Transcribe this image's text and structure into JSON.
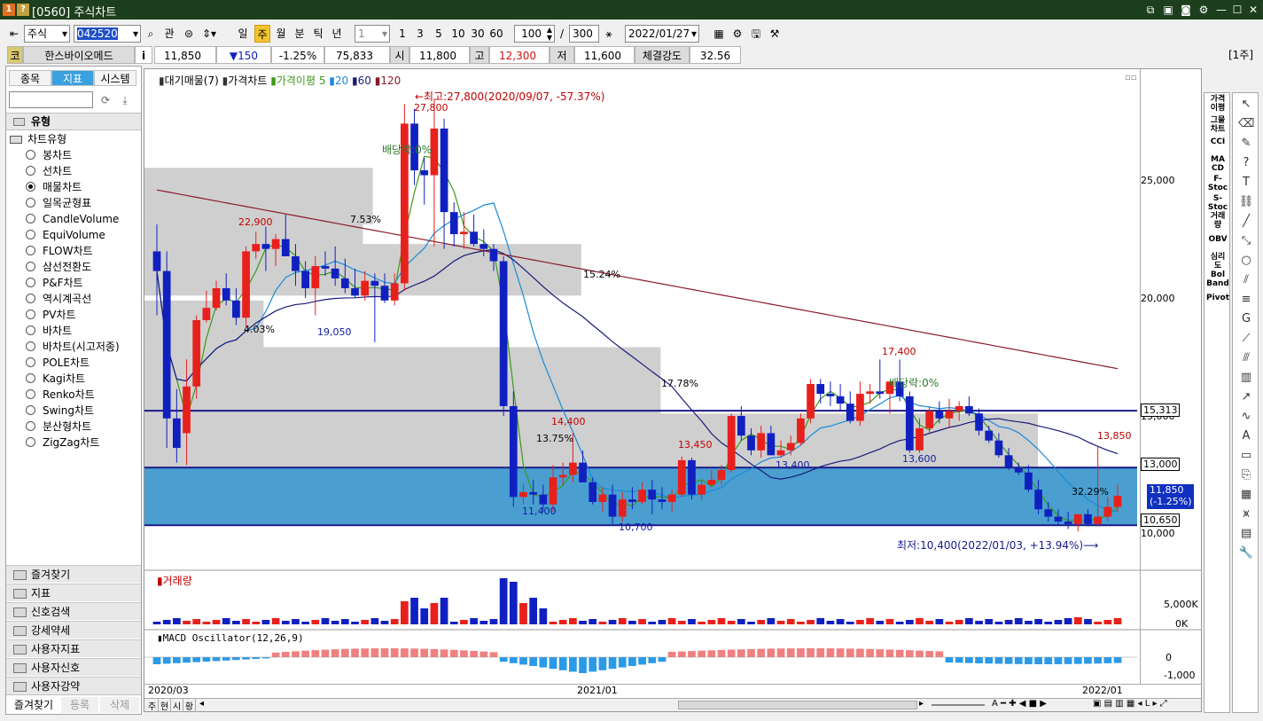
{
  "window": {
    "title": "[0560] 주식차트",
    "logo1": "1",
    "logo2": "?"
  },
  "toolbar": {
    "market": "주식",
    "code": "042520",
    "btn_gwan": "관",
    "periods": [
      "일",
      "주",
      "월",
      "분",
      "틱",
      "년"
    ],
    "interval_value": "1",
    "quick_intervals": [
      "1",
      "3",
      "5",
      "10",
      "30",
      "60"
    ],
    "count": "100",
    "slash": "/",
    "total": "300",
    "date": "2022/01/27"
  },
  "quote": {
    "kospi_label": "코",
    "name": "한스바이오메드",
    "info_btn": "i",
    "price": "11,850",
    "change": "▼150",
    "change_pct": "-1.25%",
    "volume": "75,833",
    "open_label": "시",
    "open": "11,800",
    "high_label": "고",
    "high": "12,300",
    "low_label": "저",
    "low": "11,600",
    "strength_label": "체결강도",
    "strength": "32.56",
    "unit": "[1주]"
  },
  "left": {
    "tabs": [
      "종목",
      "지표",
      "시스템"
    ],
    "section": "유형",
    "group": "차트유형",
    "chart_types": [
      "봉차트",
      "선차트",
      "매물차트",
      "일목균형표",
      "CandleVolume",
      "EquiVolume",
      "FLOW차트",
      "삼선전환도",
      "P&F차트",
      "역시계곡선",
      "PV차트",
      "바차트",
      "바차트(시고저종)",
      "POLE차트",
      "Kagi차트",
      "Renko차트",
      "Swing차트",
      "분산형차트",
      "ZigZag차트"
    ],
    "selected_index": 2,
    "folders": [
      "즐겨찾기",
      "지표",
      "신호검색",
      "강세약세",
      "사용자지표",
      "사용자신호",
      "사용자강약"
    ],
    "bottom_tabs": [
      "즐겨찾기",
      "등록",
      "삭제"
    ]
  },
  "chart": {
    "legend": {
      "vp": "대기매물(7)",
      "price": "가격차트",
      "ma_label": "가격이평",
      "ma5": "5",
      "ma20": "20",
      "ma60": "60",
      "ma120": "120"
    },
    "annotations": {
      "high": "←최고:27,800(2020/09/07, -57.37%)",
      "low": "최저:10,400(2022/01/03, +13.94%)⟶",
      "div1": "배당락:0%",
      "div2": "배당락:0%"
    },
    "labels": {
      "l27800": "27,800",
      "l22900": "22,900",
      "l19050": "19,050",
      "l14400": "14,400",
      "l13750": "13.75%",
      "l11400": "11,400",
      "l10700": "10,700",
      "l13450": "13,450",
      "l13400": "13,400",
      "l17400": "17,400",
      "l13600": "13,600",
      "l13850": "13,850",
      "l3229": "32.29%",
      "p753": "7.53%",
      "p403": "4.03%",
      "p1524": "15.24%",
      "p1778": "17.78%"
    },
    "y_ticks": [
      "25,000",
      "20,000",
      "15,000",
      "10,000"
    ],
    "hlines": [
      "15,313",
      "13,000",
      "10,650"
    ],
    "current_price": "11,850",
    "current_change": "(-1.25%)",
    "volume_label": "거래량",
    "volume_ticks": [
      "5,000K",
      "0K"
    ],
    "macd_label": "MACD Oscillator(12,26,9)",
    "macd_ticks": [
      "0",
      "-1,000"
    ],
    "x_ticks": [
      "2020/03",
      "2021/01",
      "2022/01"
    ],
    "bottom_tabs": [
      "주",
      "현",
      "시",
      "황"
    ]
  },
  "chart_data": {
    "type": "candlestick",
    "x_range": [
      "2020/03",
      "2022/01"
    ],
    "ylim": [
      9000,
      29000
    ],
    "hlines": [
      15313,
      13000,
      10650
    ],
    "high": 27800,
    "low": 10400,
    "colors": {
      "up": "#e8201c",
      "down": "#1020c0",
      "ma5": "#3a9a1a",
      "ma20": "#1a8ad8",
      "ma60": "#1a1a7a",
      "ma120": "#8a1a2a",
      "volume_profile": "#cfcfcf",
      "active_zone": "#4a9fd0"
    }
  },
  "right_indicators": [
    "가격\n이평",
    "그물\n차트",
    "CCI",
    "MA\nCD",
    "F-\nStoc",
    "S-\nStoc",
    "거래\n량",
    "OBV",
    "심리\n도",
    "Bol\nBand",
    "Pivot"
  ]
}
